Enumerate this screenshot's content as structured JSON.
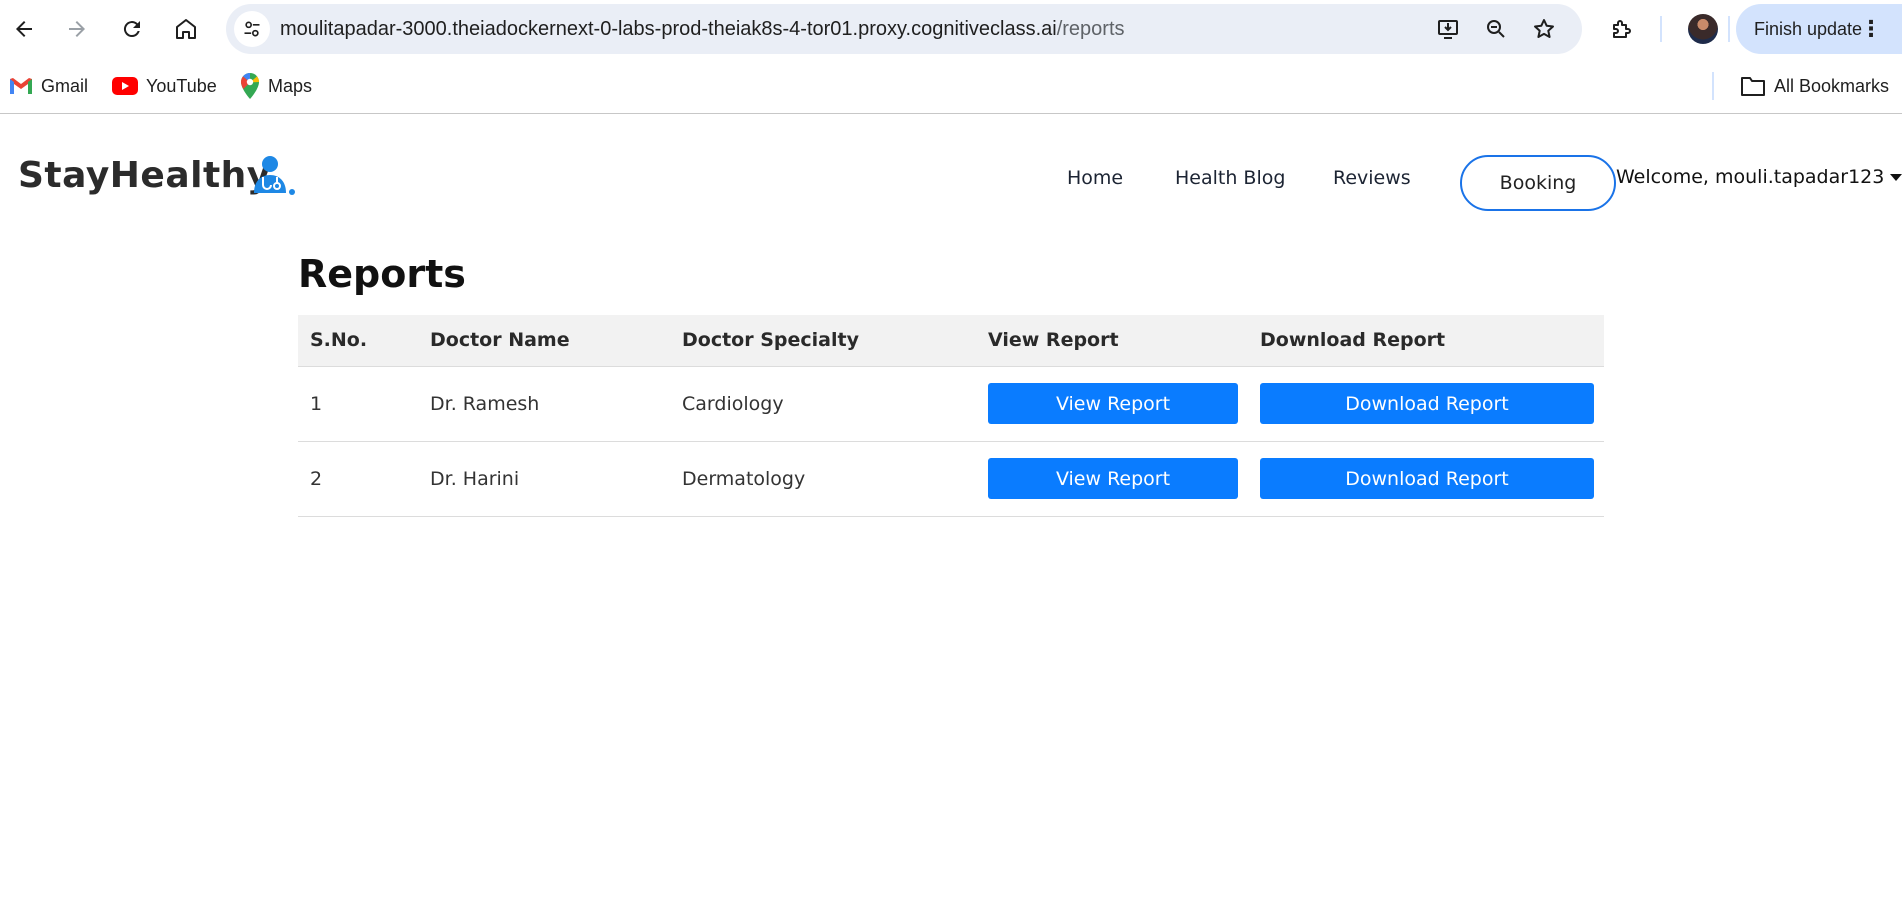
{
  "browser": {
    "url_host": "moulitapadar-3000.theiadockernext-0-labs-prod-theiak8s-4-tor01.proxy.cognitiveclass.ai",
    "url_path": "/reports",
    "finish_update_label": "Finish update",
    "bookmarks": [
      {
        "label": "Gmail",
        "icon": "gmail-icon"
      },
      {
        "label": "YouTube",
        "icon": "youtube-icon"
      },
      {
        "label": "Maps",
        "icon": "maps-icon"
      }
    ],
    "all_bookmarks_label": "All Bookmarks"
  },
  "header": {
    "brand": "StayHealthy",
    "brand_icon": "doctor-icon",
    "nav": [
      "Home",
      "Health Blog",
      "Reviews"
    ],
    "booking_label": "Booking",
    "welcome": "Welcome, mouli.tapadar123"
  },
  "main": {
    "title": "Reports",
    "columns": [
      "S.No.",
      "Doctor Name",
      "Doctor Specialty",
      "View Report",
      "Download Report"
    ],
    "rows": [
      {
        "sno": "1",
        "doctor": "Dr. Ramesh",
        "specialty": "Cardiology",
        "view_label": "View Report",
        "download_label": "Download Report"
      },
      {
        "sno": "2",
        "doctor": "Dr. Harini",
        "specialty": "Dermatology",
        "view_label": "View Report",
        "download_label": "Download Report"
      }
    ]
  },
  "colors": {
    "accent_blue": "#0a7cff",
    "booking_border": "#1a73e8",
    "header_row_bg": "#f2f2f2"
  }
}
